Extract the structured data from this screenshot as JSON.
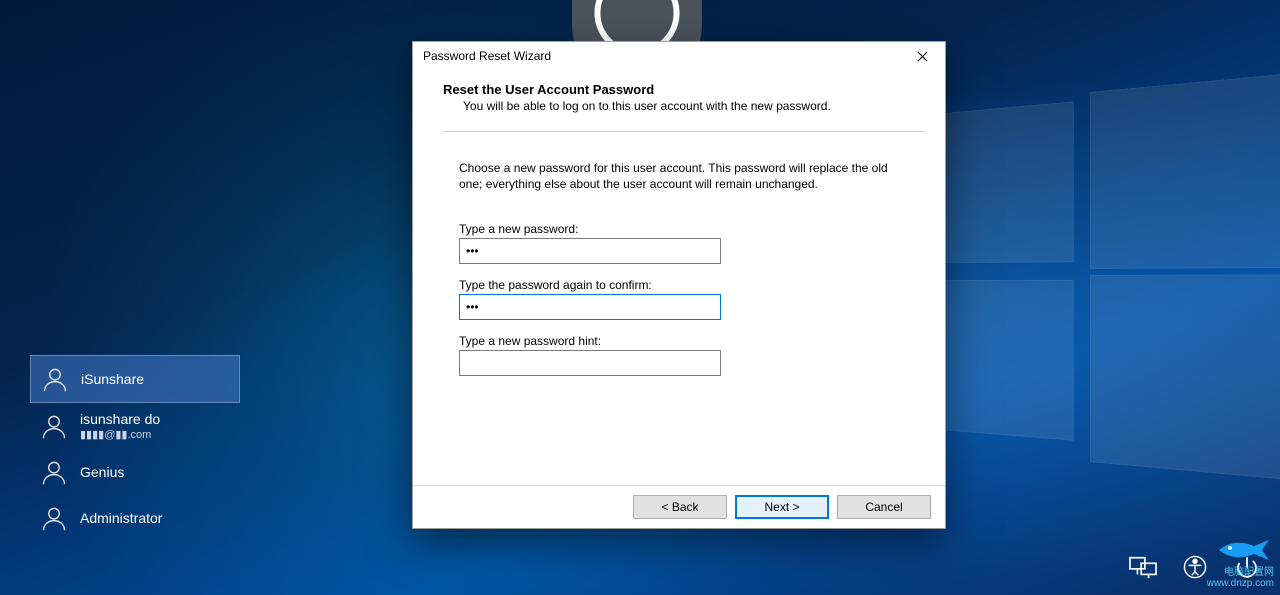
{
  "dialog": {
    "title": "Password Reset Wizard",
    "heading": "Reset the User Account Password",
    "subheading": "You will be able to log on to this user account with the new password.",
    "description": "Choose a new password for this user account. This password will replace the old one; everything else about the user account will remain unchanged.",
    "field_new_password_label": "Type a new password:",
    "field_new_password_value": "•••",
    "field_confirm_label": "Type the password again to confirm:",
    "field_confirm_value": "•••",
    "field_hint_label": "Type a new password hint:",
    "field_hint_value": "",
    "btn_back": "< Back",
    "btn_next": "Next >",
    "btn_cancel": "Cancel"
  },
  "accounts": [
    {
      "name": "iSunshare",
      "sub": "",
      "selected": true
    },
    {
      "name": "isunshare do",
      "sub": "▮▮▮▮@▮▮.com",
      "selected": false
    },
    {
      "name": "Genius",
      "sub": "",
      "selected": false
    },
    {
      "name": "Administrator",
      "sub": "",
      "selected": false
    }
  ],
  "watermark": {
    "line1": "电脑配置网",
    "line2": "www.dnzp.com"
  }
}
